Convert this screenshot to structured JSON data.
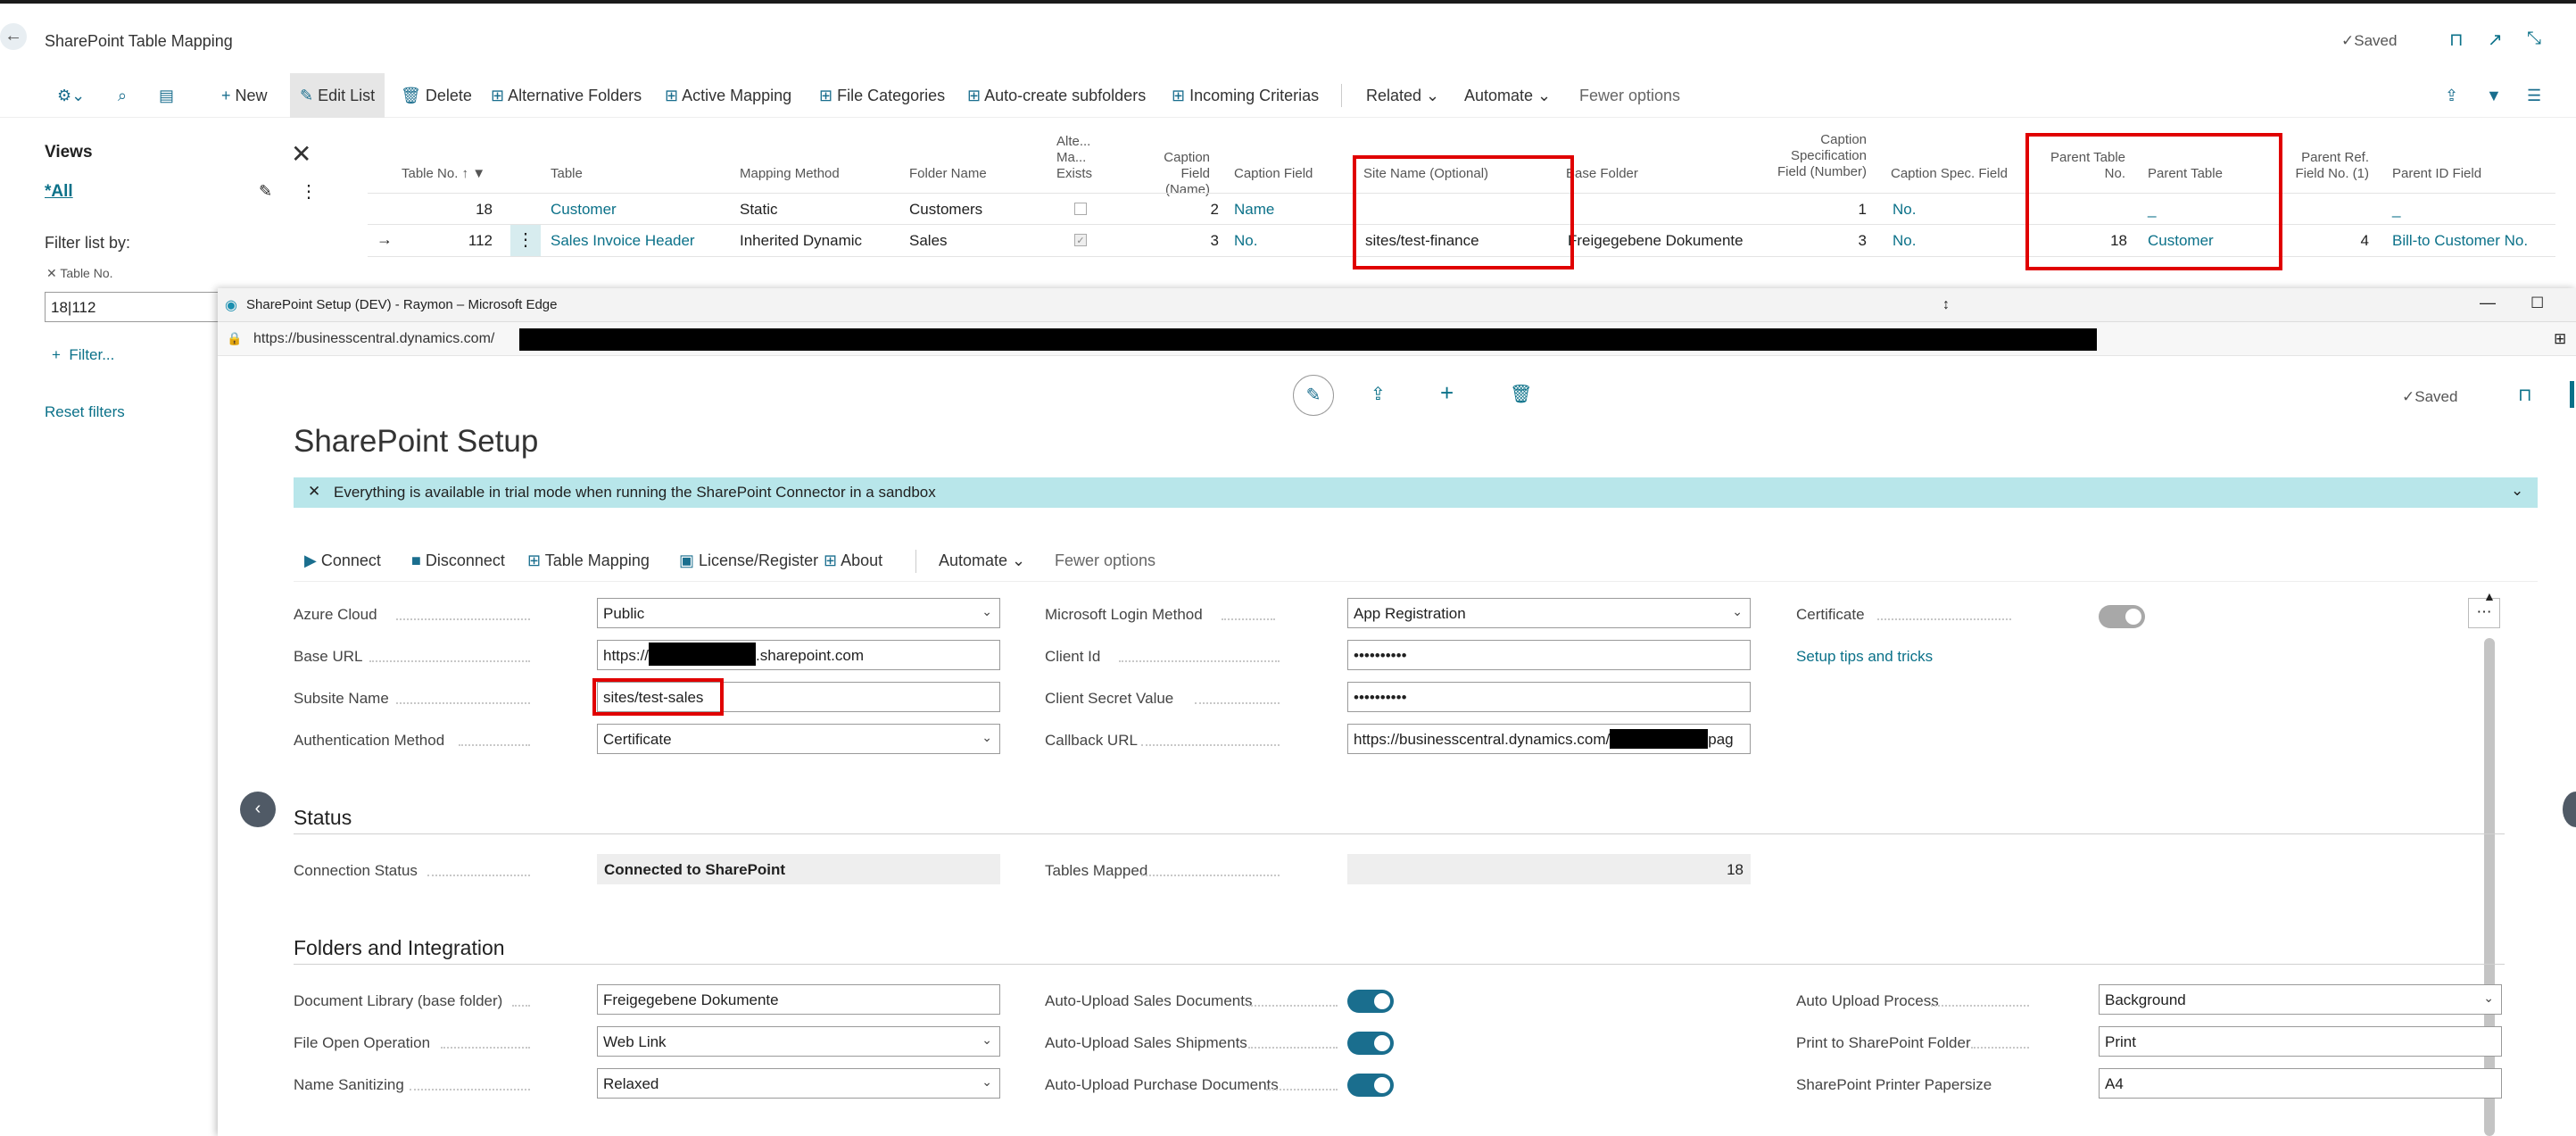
{
  "header": {
    "title": "SharePoint Table Mapping",
    "saved": "Saved"
  },
  "toolbar": {
    "new": "New",
    "edit_list": "Edit List",
    "delete": "Delete",
    "alternative_folders": "Alternative Folders",
    "active_mapping": "Active Mapping",
    "file_categories": "File Categories",
    "auto_create": "Auto-create subfolders",
    "incoming": "Incoming Criterias",
    "related": "Related",
    "automate": "Automate",
    "fewer": "Fewer options"
  },
  "views": {
    "title": "Views",
    "all": "*All",
    "filter_by": "Filter list by:",
    "filter_field": "Table No.",
    "filter_value": "18|112",
    "add_filter": "Filter...",
    "reset": "Reset filters"
  },
  "table": {
    "headers": {
      "table_no": "Table No.",
      "table": "Table",
      "mapping_method": "Mapping Method",
      "folder_name": "Folder Name",
      "alt_1": "Alte...",
      "alt_2": "Ma...",
      "alt_3": "Exists",
      "cap_name_1": "Caption Field",
      "cap_name_2": "(Name)",
      "caption_field": "Caption Field",
      "site_name": "Site Name (Optional)",
      "base_folder": "Base Folder",
      "cap_spec_1": "Caption",
      "cap_spec_2": "Specification",
      "cap_spec_3": "Field (Number)",
      "cap_spec_field": "Caption Spec. Field",
      "ptn_1": "Parent Table",
      "ptn_2": "No.",
      "parent_table": "Parent Table",
      "pref_1": "Parent Ref.",
      "pref_2": "Field No. (1)",
      "parent_id": "Parent ID Field"
    },
    "rows": [
      {
        "table_no": "18",
        "table": "Customer",
        "mapping": "Static",
        "folder": "Customers",
        "cap_num": "2",
        "caption_field": "Name",
        "site": "",
        "base": "",
        "spec_num": "1",
        "spec_field": "No.",
        "parent_no": "",
        "parent_table": "_",
        "ref_no": "",
        "parent_id": "_"
      },
      {
        "table_no": "112",
        "table": "Sales Invoice Header",
        "mapping": "Inherited Dynamic",
        "folder": "Sales",
        "cap_num": "3",
        "caption_field": "No.",
        "site": "sites/test-finance",
        "base": "Freigegebene Dokumente",
        "spec_num": "3",
        "spec_field": "No.",
        "parent_no": "18",
        "parent_table": "Customer",
        "ref_no": "4",
        "parent_id": "Bill-to Customer No."
      }
    ]
  },
  "browser": {
    "title": "SharePoint Setup (DEV) - Raymon – Microsoft Edge",
    "url": "https://businesscentral.dynamics.com/"
  },
  "setup": {
    "title": "SharePoint Setup",
    "saved": "Saved",
    "banner": "Everything is available in trial mode when running the SharePoint Connector in a sandbox",
    "actions": {
      "connect": "Connect",
      "disconnect": "Disconnect",
      "table_mapping": "Table Mapping",
      "license": "License/Register",
      "about": "About",
      "automate": "Automate",
      "fewer": "Fewer options"
    },
    "general": {
      "azure_cloud_label": "Azure Cloud",
      "azure_cloud": "Public",
      "base_url_label": "Base URL",
      "base_url_prefix": "https://",
      "base_url_suffix": ".sharepoint.com",
      "subsite_label": "Subsite Name",
      "subsite": "sites/test-sales",
      "auth_label": "Authentication Method",
      "auth": "Certificate",
      "login_label": "Microsoft Login Method",
      "login": "App Registration",
      "client_id_label": "Client Id",
      "client_id": "••••••••••",
      "secret_label": "Client Secret Value",
      "secret": "••••••••••",
      "callback_label": "Callback URL",
      "callback_prefix": "https://businesscentral.dynamics.com/",
      "callback_suffix": "pag",
      "certificate_label": "Certificate",
      "tips": "Setup tips and tricks"
    },
    "status": {
      "title": "Status",
      "conn_label": "Connection Status",
      "conn": "Connected to SharePoint",
      "tables_label": "Tables Mapped",
      "tables": "18"
    },
    "folders": {
      "title": "Folders and Integration",
      "doclib_label": "Document Library (base folder)",
      "doclib": "Freigegebene Dokumente",
      "fileopen_label": "File Open Operation",
      "fileopen": "Web Link",
      "sanitize_label": "Name Sanitizing",
      "sanitize": "Relaxed",
      "up_sales_label": "Auto-Upload Sales Documents",
      "up_ship_label": "Auto-Upload Sales Shipments",
      "up_purch_label": "Auto-Upload Purchase Documents",
      "process_label": "Auto Upload Process",
      "process": "Background",
      "print_label": "Print to SharePoint Folder",
      "print": "Print",
      "paper_label": "SharePoint Printer Papersize",
      "paper": "A4"
    }
  }
}
